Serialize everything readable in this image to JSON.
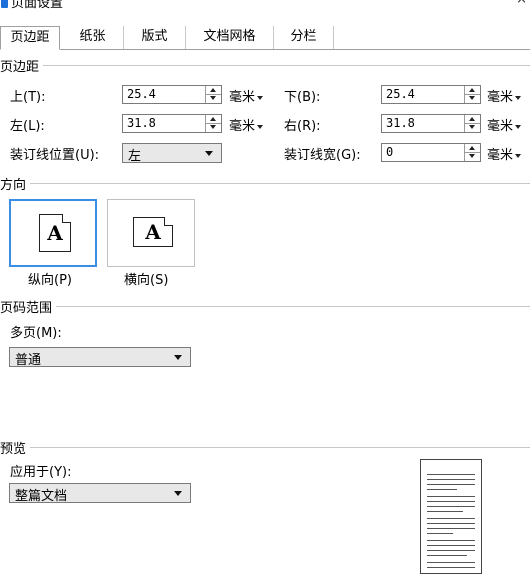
{
  "window": {
    "title": "页面设置",
    "close_glyph": "×"
  },
  "tabs": [
    {
      "label": "页边距",
      "active": true
    },
    {
      "label": "纸张",
      "active": false
    },
    {
      "label": "版式",
      "active": false
    },
    {
      "label": "文档网格",
      "active": false
    },
    {
      "label": "分栏",
      "active": false
    }
  ],
  "margins": {
    "group_title": "页边距",
    "top_label": "上(T):",
    "top_value": "25.4",
    "bottom_label": "下(B):",
    "bottom_value": "25.4",
    "left_label": "左(L):",
    "left_value": "31.8",
    "right_label": "右(R):",
    "right_value": "31.8",
    "gutter_pos_label": "装订线位置(U):",
    "gutter_pos_value": "左",
    "gutter_width_label": "装订线宽(G):",
    "gutter_width_value": "0",
    "unit": "毫米"
  },
  "orientation": {
    "group_title": "方向",
    "portrait_label": "纵向(P)",
    "landscape_label": "横向(S)",
    "icon_letter": "A",
    "selected": "portrait"
  },
  "pages": {
    "group_title": "页码范围",
    "multi_label": "多页(M):",
    "multi_value": "普通"
  },
  "preview": {
    "group_title": "预览",
    "apply_label": "应用于(Y):",
    "apply_value": "整篇文档"
  },
  "colors": {
    "selected_border": "#3a8ee6",
    "title_icon": "#1e6fd9"
  }
}
